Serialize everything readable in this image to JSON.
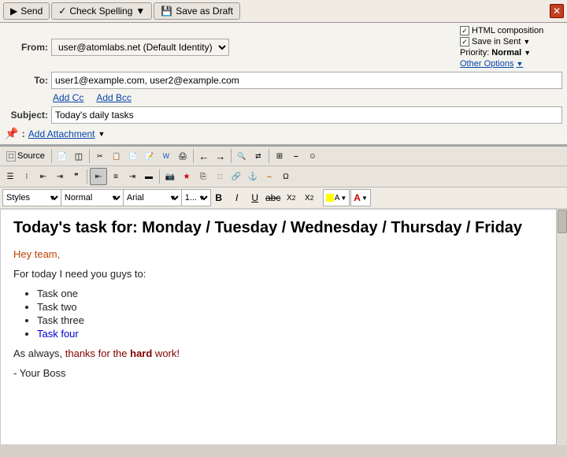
{
  "toolbar": {
    "send_label": "Send",
    "check_spelling_label": "Check Spelling",
    "save_draft_label": "Save as Draft"
  },
  "header": {
    "from_label": "From:",
    "from_value": "user@atomlabs.net (Default Identity)",
    "to_label": "To:",
    "to_value": "user1@example.com, user2@example.com",
    "add_cc": "Add Cc",
    "add_bcc": "Add Bcc",
    "subject_label": "Subject:",
    "subject_value": "Today's daily tasks",
    "attach_label": "Add Attachment",
    "html_composition": "HTML composition",
    "save_in_sent": "Save in Sent",
    "priority_label": "Priority:",
    "priority_value": "Normal",
    "other_options": "Other Options"
  },
  "editor": {
    "source_btn": "Source",
    "styles_label": "Styles",
    "normal_label": "Normal",
    "font_label": "Arial",
    "size_label": "1..."
  },
  "content": {
    "title": "Today's task for: Monday / Tuesday / Wednesday / Thursday / Friday",
    "greeting": "Hey team,",
    "intro": "For today I need you guys to:",
    "tasks": [
      "Task one",
      "Task two",
      "Task three",
      "Task four"
    ],
    "closing": "As always, thanks for the hard work!",
    "sign": "- Your Boss"
  }
}
